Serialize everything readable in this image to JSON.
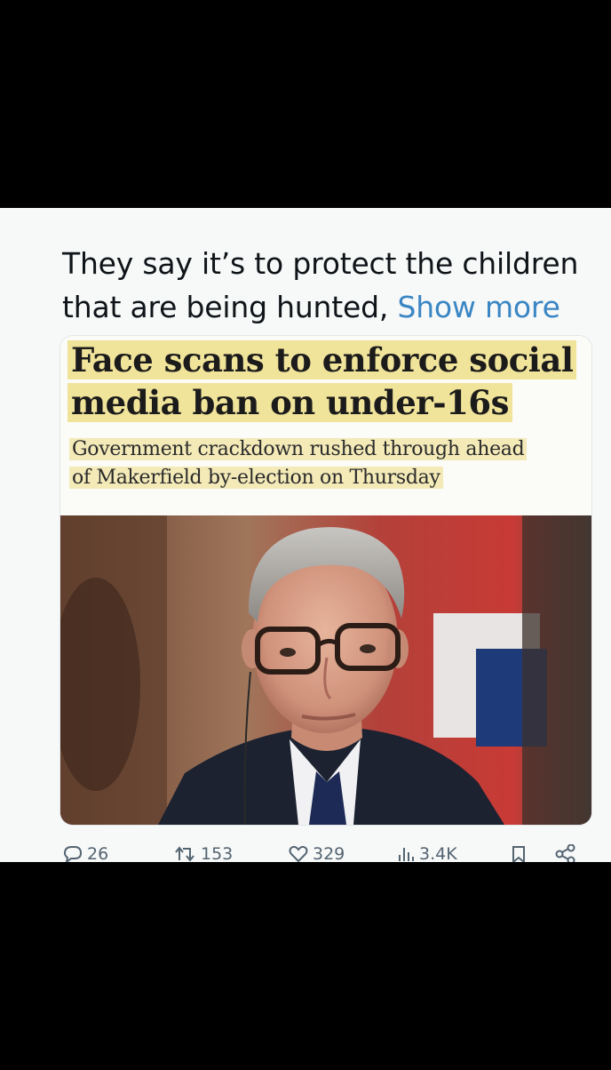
{
  "tweet": {
    "text_line1": "They say it’s to protect the children",
    "text_line2": "that are being hunted, ",
    "show_more": "Show more"
  },
  "card": {
    "headline_line1": "Face scans to enforce social",
    "headline_line2": "media ban on under-16s",
    "subhead_line1": "Government crackdown rushed through ahead",
    "subhead_line2": "of Makerfield by-election on Thursday",
    "highlight_color": "#f0e39a"
  },
  "actions": {
    "replies": "26",
    "reposts": "153",
    "likes": "329",
    "views": "3.4K"
  },
  "colors": {
    "link": "#3a86c4",
    "text": "#0f1419",
    "muted": "#536471"
  }
}
